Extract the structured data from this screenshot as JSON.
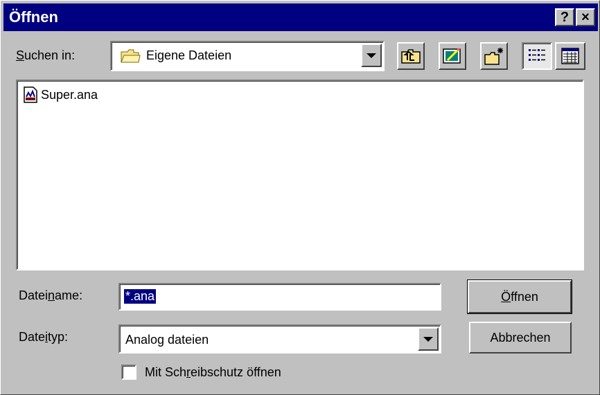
{
  "window": {
    "title": "Öffnen",
    "help_glyph": "?",
    "close_glyph": "×"
  },
  "lookin": {
    "label_first": "S",
    "label_rest": "uchen in:",
    "value": "Eigene Dateien",
    "icon": "folder-icon"
  },
  "toolbar": {
    "icons": [
      "up-one-level-icon",
      "desktop-icon",
      "new-folder-icon",
      "list-view-icon",
      "details-view-icon"
    ]
  },
  "files": [
    {
      "name": "Super.ana",
      "icon": "document-file-icon"
    }
  ],
  "filename": {
    "label_a": "Datei",
    "label_u": "n",
    "label_b": "ame:",
    "value": "*.ana"
  },
  "filetype": {
    "label_a": "Date",
    "label_u": "i",
    "label_b": "typ:",
    "value": "Analog dateien"
  },
  "readonly": {
    "label_a": "Mit Sch",
    "label_u": "r",
    "label_b": "eibschutz öffnen",
    "checked": false
  },
  "buttons": {
    "open_first": "Ö",
    "open_rest": "ffnen",
    "cancel": "Abbrechen"
  },
  "colors": {
    "titlebar": "#000080",
    "face": "#c0c0c0",
    "selection": "#000080"
  }
}
